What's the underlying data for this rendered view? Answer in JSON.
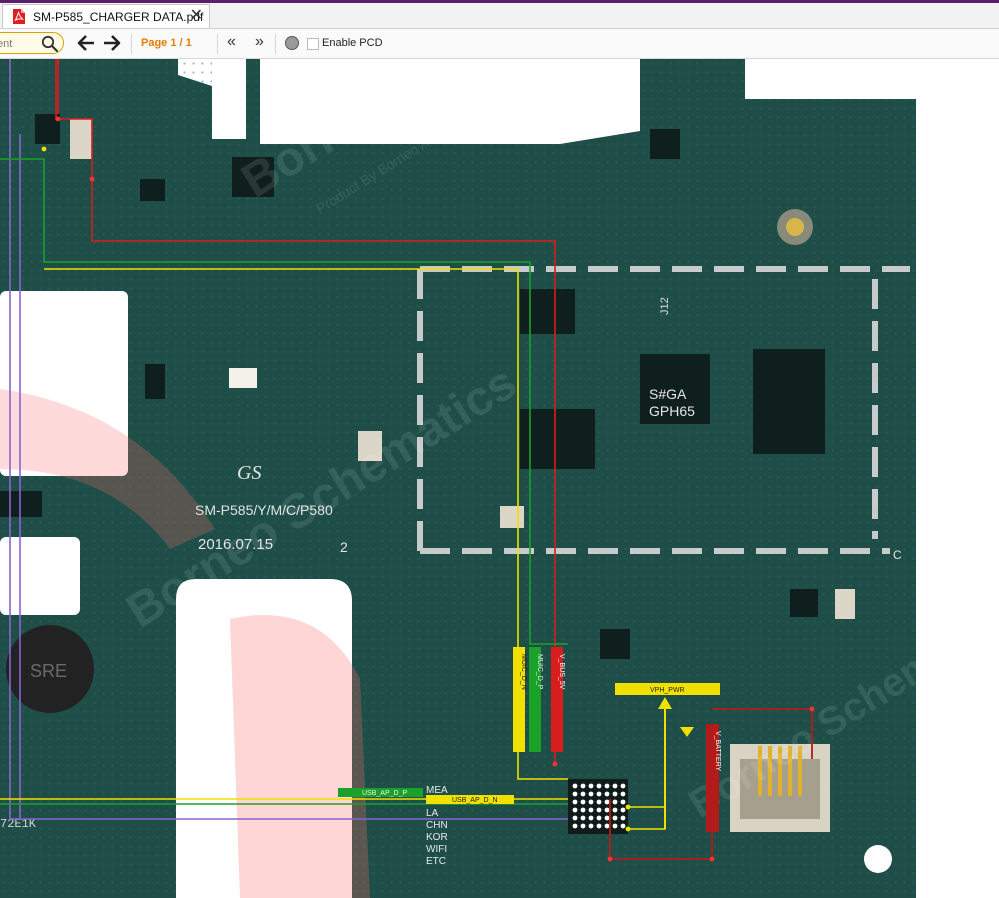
{
  "window": {
    "accent_strip_color": "#5a1f6a"
  },
  "tabs": [
    {
      "title": "SM-P585_CHARGER DATA.pdf",
      "icon": "pdf-icon",
      "active": true
    }
  ],
  "toolbar": {
    "search_value": "ent",
    "page_indicator": "Page 1 / 1",
    "enable_pcd_label": "Enable PCD",
    "enable_pcd_checked": false
  },
  "board": {
    "model_text": "SM-P585/Y/M/C/P580",
    "date_text": "2016.07.15",
    "corner_label_2": "2",
    "corner_label_c": "C",
    "chip_main_text": "S#GA\nGPH65",
    "chip_j12_text": "J12",
    "logo_text": "GS",
    "watermarks": [
      "Borneo Schematics",
      "Product By Borneo Aleger"
    ],
    "silkscreen_labels": [
      "MEA",
      "LA",
      "CHN",
      "KOR",
      "WIFI",
      "ETC"
    ],
    "component_tag": "SRE",
    "partial_label": "72E1K"
  },
  "nets": [
    {
      "name": "MUIC_D_N",
      "color": "#f0e000"
    },
    {
      "name": "MUIC_D_P",
      "color": "#1aa12a"
    },
    {
      "name": "V_BUS_5V",
      "color": "#d81d1d"
    },
    {
      "name": "VPH_PWR",
      "color": "#f0e000"
    },
    {
      "name": "V_BATTERY",
      "color": "#b31b1b"
    },
    {
      "name": "USB_AP_D_P",
      "color": "#1aa12a"
    },
    {
      "name": "USB_AP_D_N",
      "color": "#f0e000"
    }
  ],
  "colors": {
    "pcb": "#1e4e47",
    "pcb_dark": "#173f39",
    "trace_purple": "#8a63d2",
    "trace_red": "#d81d1d",
    "trace_yellow": "#f0e000",
    "trace_green": "#1aa12a"
  }
}
